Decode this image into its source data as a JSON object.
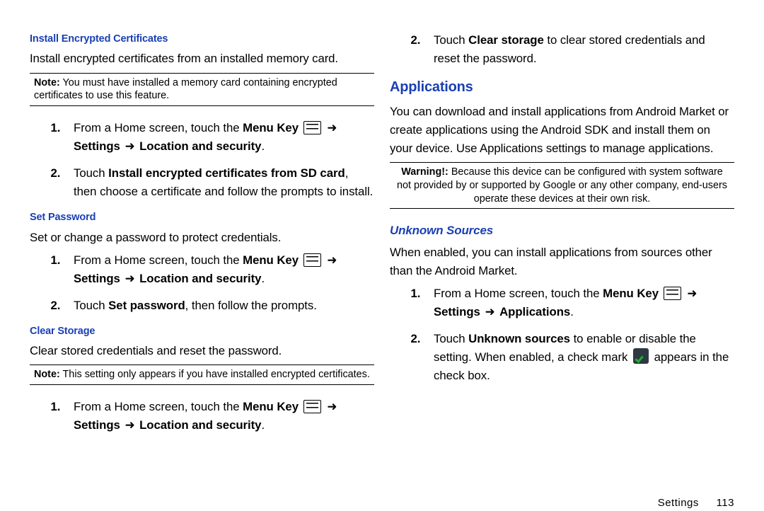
{
  "left": {
    "install_certs": {
      "title": "Install Encrypted Certificates",
      "desc": "Install encrypted certificates from an installed memory card.",
      "note_label": "Note:",
      "note": " You must have installed a memory card containing encrypted certificates to use this feature.",
      "step1_a": "From a Home screen, touch the ",
      "step1_menukey": "Menu Key",
      "step1_settings": "Settings",
      "step1_b": "Location and security",
      "step2_a": "Touch ",
      "step2_bold": "Install encrypted certificates from SD card",
      "step2_b": ", then choose a certificate and follow the prompts to install."
    },
    "set_pw": {
      "title": "Set Password",
      "desc": "Set or change a password to protect credentials.",
      "step1_a": "From a Home screen, touch the ",
      "step1_menukey": "Menu Key",
      "step1_settings": "Settings",
      "step1_b": "Location and security",
      "step2_a": "Touch ",
      "step2_bold": "Set password",
      "step2_b": ", then follow the prompts."
    },
    "clear": {
      "title": "Clear Storage",
      "desc": "Clear stored credentials and reset the password.",
      "note_label": "Note:",
      "note": " This setting only appears if you have installed encrypted certificates.",
      "step1_a": "From a Home screen, touch the ",
      "step1_menukey": "Menu Key",
      "step1_settings": "Settings",
      "step1_b": "Location and security"
    }
  },
  "right": {
    "top_step2_a": "Touch ",
    "top_step2_bold": "Clear storage",
    "top_step2_b": " to clear stored credentials and reset the password.",
    "apps": {
      "title": "Applications",
      "desc": "You can download and install applications from Android Market or create applications using the Android SDK and install them on your device. Use Applications settings to manage applications.",
      "warn_label": "Warning!:",
      "warn": " Because this device can be configured with system software not provided by or supported by Google or any other company, end-users operate these devices at their own risk."
    },
    "unknown": {
      "title": "Unknown Sources",
      "desc": "When enabled, you can install applications from sources other than the Android Market.",
      "step1_a": "From a Home screen, touch the ",
      "step1_menukey": "Menu Key",
      "step1_settings": "Settings",
      "step1_b": "Applications",
      "step2_a": "Touch ",
      "step2_bold": "Unknown sources",
      "step2_b": " to enable or disable the setting. When enabled, a check mark ",
      "step2_c": " appears in the check box."
    }
  },
  "arrow": "➜",
  "footer": {
    "section": "Settings",
    "page": "113"
  }
}
